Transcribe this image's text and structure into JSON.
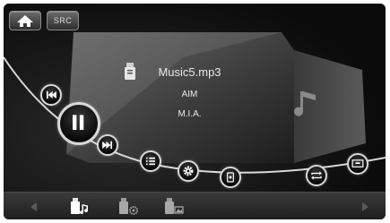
{
  "header": {
    "home_icon": "home-icon",
    "src_label": "SRC"
  },
  "track": {
    "filename": "Music5.mp3",
    "album": "AIM",
    "artist": "M.I.A.",
    "source_icon": "usb-icon",
    "album_art_icon": "music-note-icon"
  },
  "controls": [
    {
      "name": "previous-track-button",
      "icon": "skip-previous-icon"
    },
    {
      "name": "pause-button",
      "icon": "pause-icon"
    },
    {
      "name": "next-track-button",
      "icon": "skip-next-icon"
    },
    {
      "name": "list-button",
      "icon": "list-icon"
    },
    {
      "name": "settings-button",
      "icon": "gear-icon"
    },
    {
      "name": "info-button",
      "icon": "info-icon"
    },
    {
      "name": "repeat-button",
      "icon": "repeat-icon"
    },
    {
      "name": "screen-button",
      "icon": "screen-icon"
    }
  ],
  "bottom_bar": {
    "left_arrow_icon": "chevron-left-icon",
    "right_arrow_icon": "chevron-right-icon",
    "sources": [
      {
        "name": "usb-music-source",
        "icon": "usb-music-icon",
        "active": true
      },
      {
        "name": "usb-video-source",
        "icon": "usb-video-icon",
        "active": false
      },
      {
        "name": "usb-image-source",
        "icon": "usb-image-icon",
        "active": false
      }
    ]
  },
  "colors": {
    "background": "#0b0b0b",
    "accent_white": "#ffffff",
    "button_border": "#d9d9d9"
  }
}
